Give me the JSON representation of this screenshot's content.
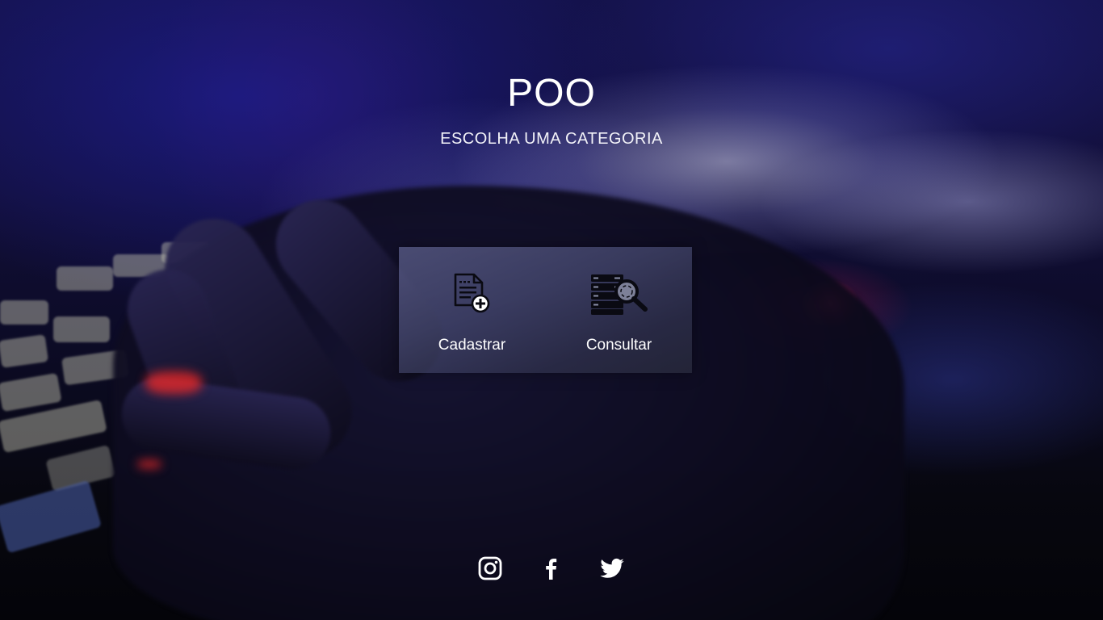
{
  "header": {
    "title": "POO",
    "subtitle": "ESCOLHA UMA CATEGORIA"
  },
  "categories": [
    {
      "label": "Cadastrar",
      "icon": "document-add-icon"
    },
    {
      "label": "Consultar",
      "icon": "database-search-icon"
    }
  ],
  "social": [
    {
      "icon": "instagram-icon"
    },
    {
      "icon": "facebook-icon"
    },
    {
      "icon": "twitter-icon"
    }
  ],
  "colors": {
    "text": "#ffffff",
    "background": "#0c0b26",
    "glow": "#ff3c6e"
  }
}
